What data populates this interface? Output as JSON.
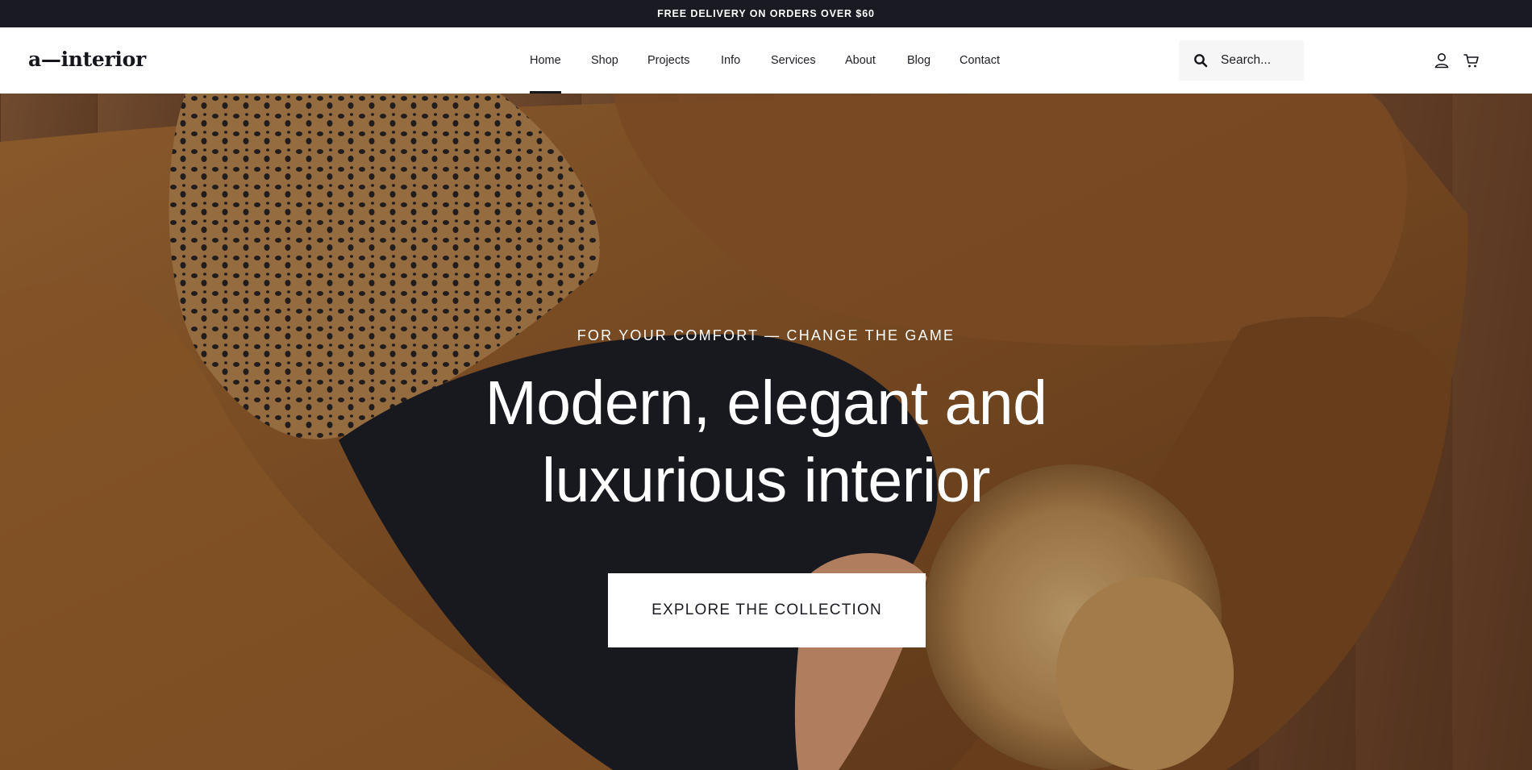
{
  "announcement": {
    "text": "FREE DELIVERY ON ORDERS OVER $60"
  },
  "header": {
    "logo": "a—interior",
    "nav": [
      {
        "label": "Home",
        "active": true
      },
      {
        "label": "Shop"
      },
      {
        "label": "Projects"
      },
      {
        "label": "Info"
      },
      {
        "label": "Services"
      },
      {
        "label": "About"
      },
      {
        "label": "Blog"
      },
      {
        "label": "Contact"
      }
    ],
    "search": {
      "placeholder": "Search..."
    },
    "icons": [
      "user-icon",
      "cart-icon"
    ]
  },
  "hero": {
    "eyebrow": "FOR YOUR COMFORT — CHANGE THE GAME",
    "headline_line1": "Modern, elegant and",
    "headline_line2": "luxurious interior",
    "cta_label": "EXPLORE THE COLLECTION"
  },
  "colors": {
    "topbar_bg": "#1a1b22",
    "accent": "#15161c",
    "hero_sofa": "#9a6330",
    "hero_dark": "#1c1d24"
  }
}
